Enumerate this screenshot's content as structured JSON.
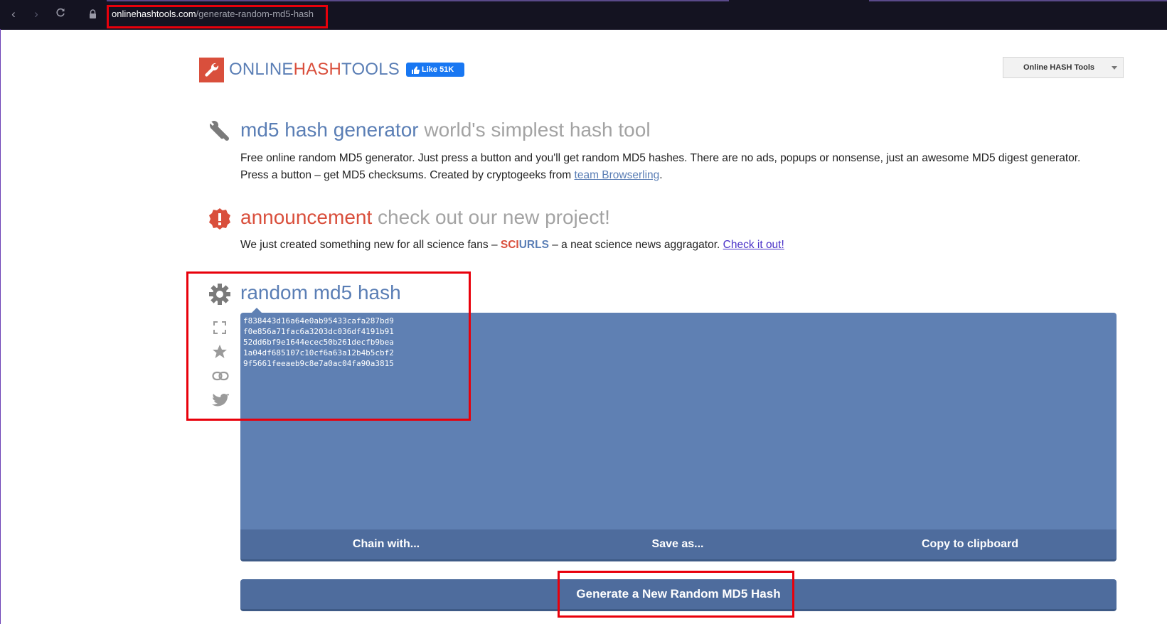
{
  "browser": {
    "url_host": "onlinehashtools.com",
    "url_path": "/generate-random-md5-hash"
  },
  "header": {
    "logo_part1": "ONLINE",
    "logo_part2": "HASH",
    "logo_part3": "TOOLS",
    "like_label": "Like 51K",
    "dropdown_label": "Online HASH Tools"
  },
  "intro": {
    "title": "md5 hash generator",
    "subtitle": "world's simplest hash tool",
    "line1": "Free online random MD5 generator. Just press a button and you'll get random MD5 hashes. There are no ads, popups or nonsense, just an awesome MD5 digest generator.",
    "line2_prefix": "Press a button – get MD5 checksums. Created by cryptogeeks from ",
    "line2_link": "team Browserling",
    "line2_suffix": "."
  },
  "announcement": {
    "title": "announcement",
    "subtitle": "check out our new project!",
    "text_prefix": "We just created something new for all science fans – ",
    "sci": "SCI",
    "urls": "URLS",
    "text_middle": " – a neat science news aggragator. ",
    "link": "Check it out!"
  },
  "tool": {
    "title": "random md5 hash",
    "hashes": "f838443d16a64e0ab95433cafa287bd9\nf0e856a71fac6a3203dc036df4191b91\n52dd6bf9e1644ecec50b261decfb9bea\n1a04df685107c10cf6a63a12b4b5cbf2\n9f5661feeaeb9c8e7a0ac04fa90a3815",
    "chain_label": "Chain with...",
    "save_label": "Save as...",
    "copy_label": "Copy to clipboard",
    "generate_label": "Generate a New Random MD5 Hash"
  },
  "colors": {
    "accent_blue": "#5a7eb5",
    "accent_red": "#d94f3c",
    "panel": "#5f80b3",
    "annotation_red": "#e8000b"
  }
}
